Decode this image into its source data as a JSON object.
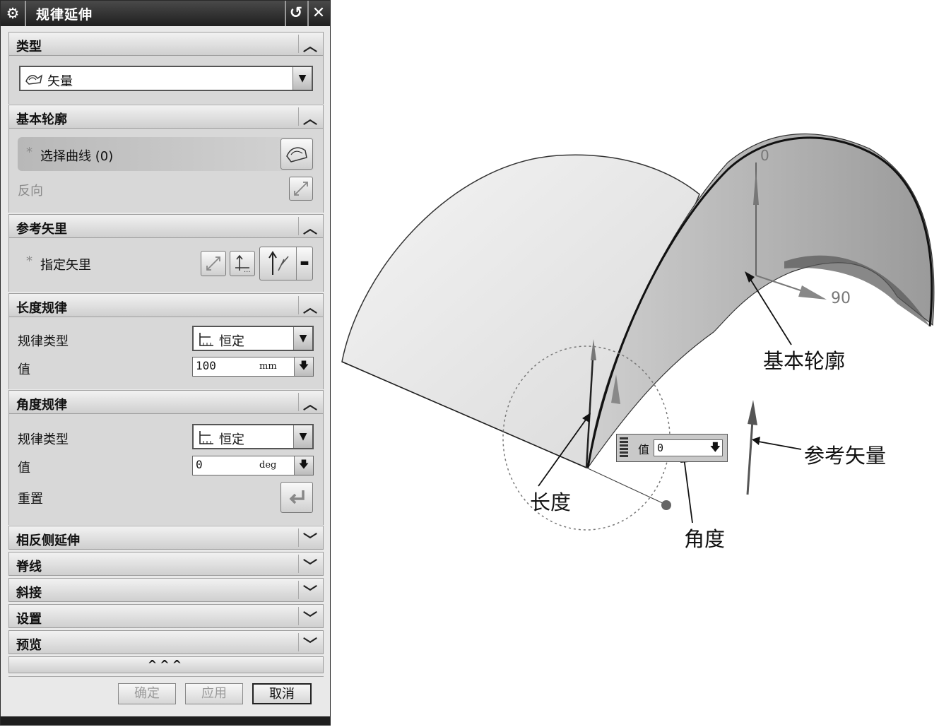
{
  "dialog": {
    "title": "规律延伸",
    "sections": {
      "type": {
        "label": "类型",
        "value": "矢量"
      },
      "base_profile": {
        "label": "基本轮廓",
        "select_curve": "选择曲线 (0)",
        "reverse": "反向"
      },
      "ref_vector": {
        "label": "参考矢里",
        "specify_vector": "指定矢里"
      },
      "length_law": {
        "label": "长度规律",
        "law_type_label": "规律类型",
        "law_type_value": "恒定",
        "value_label": "值",
        "value": "100",
        "unit": "mm"
      },
      "angle_law": {
        "label": "角度规律",
        "law_type_label": "规律类型",
        "law_type_value": "恒定",
        "value_label": "值",
        "value": "0",
        "unit": "deg",
        "reset_label": "重置"
      },
      "collapsed": [
        "相反侧延伸",
        "脊线",
        "斜接",
        "设置",
        "预览"
      ]
    },
    "more_label": "^^^",
    "buttons": {
      "ok": "确定",
      "apply": "应用",
      "cancel": "取消"
    },
    "asterisk": "*"
  },
  "viewport": {
    "dim_top": "0",
    "dim_angle": "90",
    "handle_label": "值",
    "handle_value": "0",
    "callouts": {
      "base_profile": "基本轮廓",
      "ref_vector": "参考矢量",
      "length": "长度",
      "angle": "角度"
    }
  }
}
